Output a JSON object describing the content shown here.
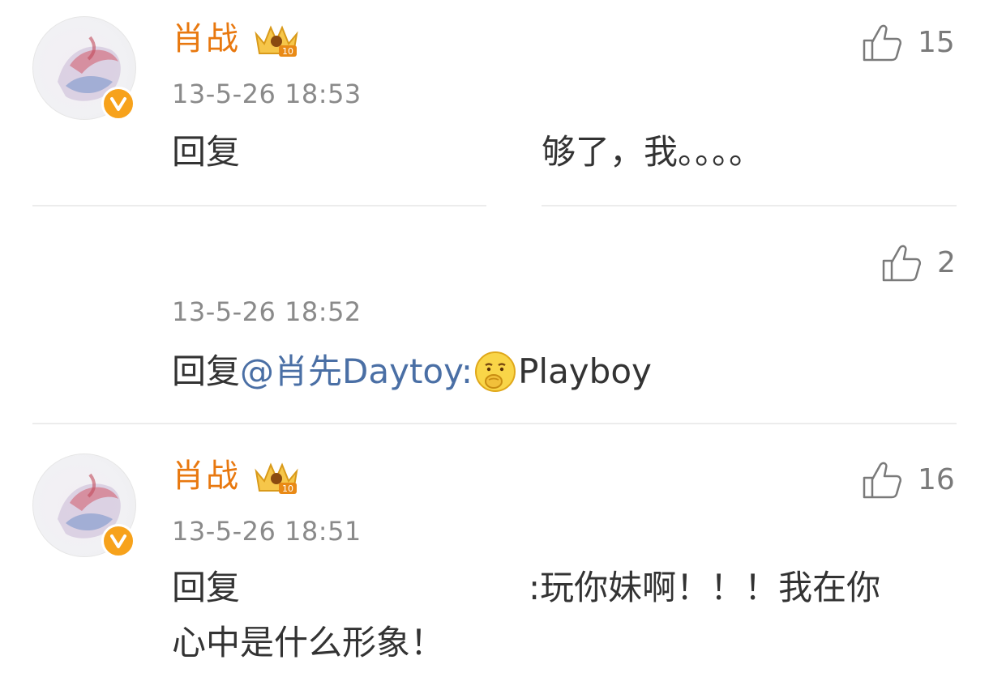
{
  "comments": [
    {
      "username": "肖战",
      "timestamp": "13-5-26 18:53",
      "likes": "15",
      "reply_prefix": "回复",
      "reply_text": "够了，我。。。。"
    },
    {
      "timestamp": "13-5-26 18:52",
      "likes": "2",
      "reply_prefix": "回复",
      "mention": "@肖先Daytoy:",
      "emoji": "thinking-face-emoji",
      "reply_text": "Playboy"
    },
    {
      "username": "肖战",
      "timestamp": "13-5-26 18:51",
      "likes": "16",
      "reply_prefix": "回复",
      "reply_text_line1": ":玩你妹啊！！！我在你",
      "reply_text_line2": "心中是什么形象！"
    }
  ],
  "colors": {
    "username": "#e8780f",
    "mention": "#4a6fa5",
    "verified_badge": "#f7a21b",
    "timestamp": "#8a8a8a"
  },
  "icons": {
    "like": "thumbs-up-icon",
    "verified": "verified-v-icon",
    "crown": "crown-level-badge-icon"
  }
}
